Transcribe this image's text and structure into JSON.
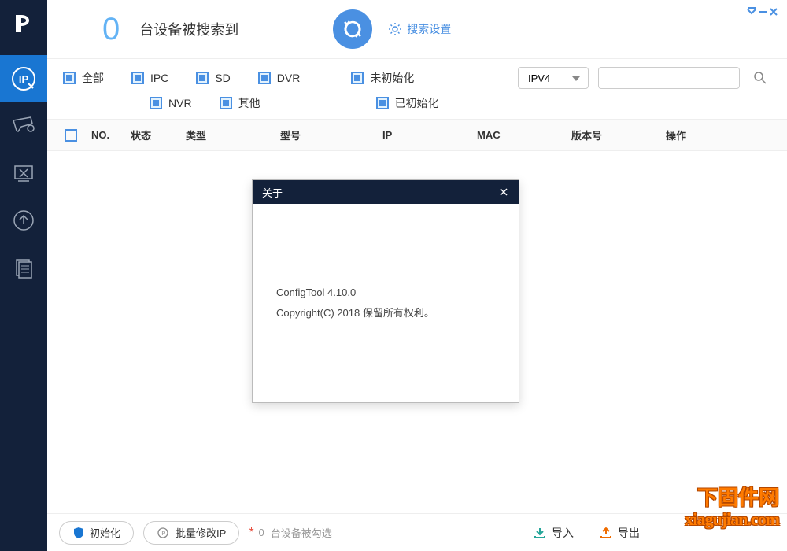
{
  "header": {
    "device_count": "0",
    "device_label": "台设备被搜索到",
    "search_settings": "搜索设置"
  },
  "filters": {
    "all": "全部",
    "ipc": "IPC",
    "sd": "SD",
    "dvr": "DVR",
    "nvr": "NVR",
    "other": "其他",
    "uninitialized": "未初始化",
    "initialized": "已初始化",
    "ip_version": "IPV4",
    "search_placeholder": ""
  },
  "table_headers": {
    "no": "NO.",
    "status": "状态",
    "type": "类型",
    "model": "型号",
    "ip": "IP",
    "mac": "MAC",
    "version": "版本号",
    "action": "操作"
  },
  "about_dialog": {
    "title": "关于",
    "product": "ConfigTool 4.10.0",
    "copyright": "Copyright(C) 2018 保留所有权利。"
  },
  "bottom": {
    "init_btn": "初始化",
    "batch_ip_btn": "批量修改IP",
    "selected_count": "0",
    "selected_label": "台设备被勾选",
    "import": "导入",
    "export": "导出"
  },
  "watermark": {
    "line1": "下固件网",
    "line2": "xiagujian.com"
  }
}
